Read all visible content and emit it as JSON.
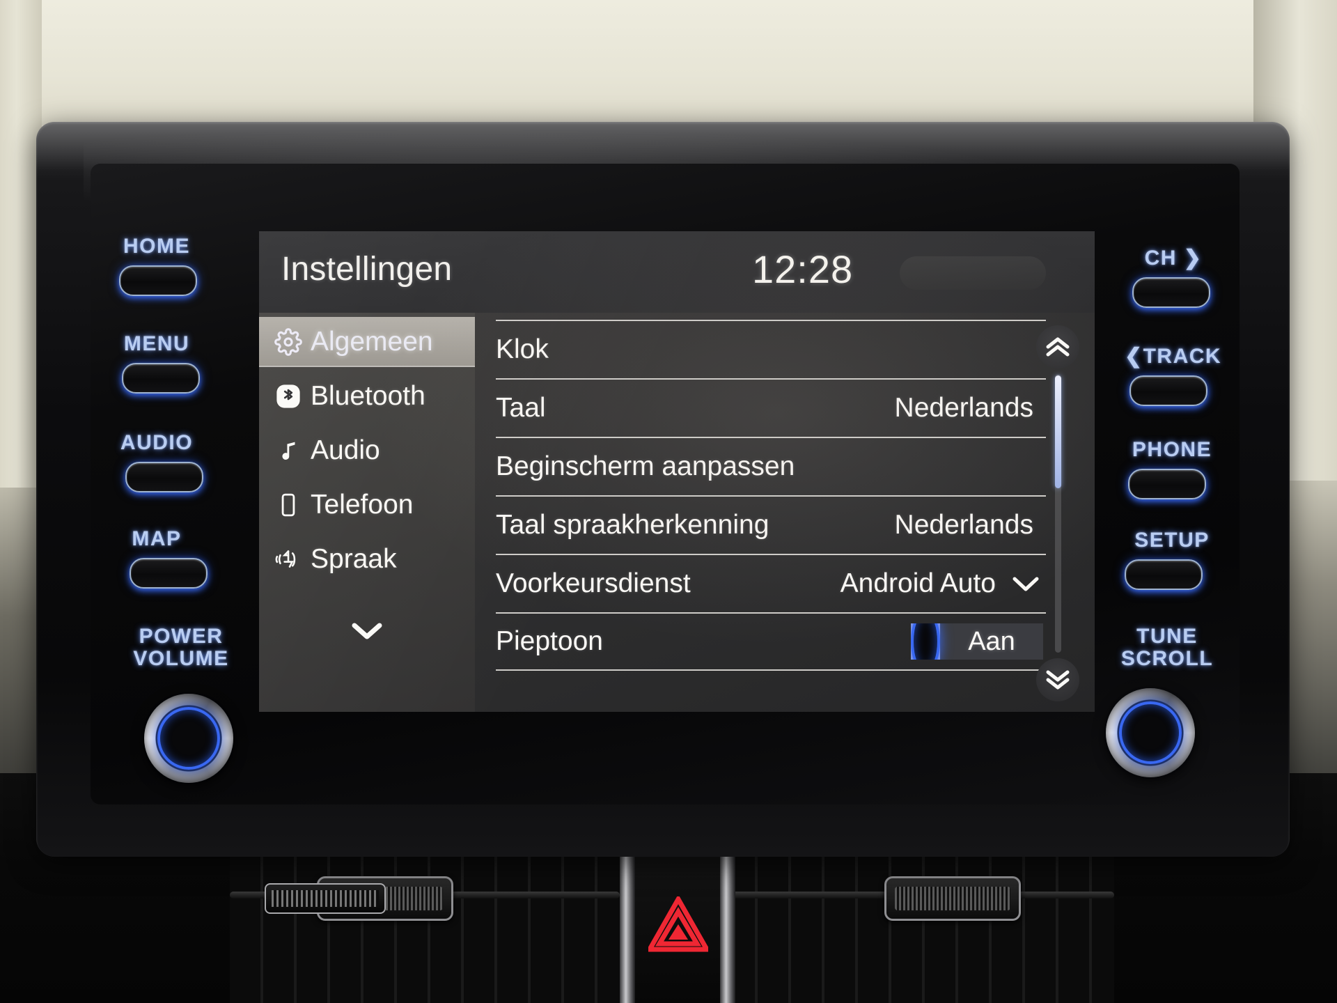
{
  "header": {
    "title": "Instellingen",
    "clock": "12:28"
  },
  "sidebar": {
    "items": [
      {
        "label": "Algemeen",
        "icon": "gear-icon",
        "selected": true
      },
      {
        "label": "Bluetooth",
        "icon": "bluetooth-icon",
        "selected": false
      },
      {
        "label": "Audio",
        "icon": "music-note-icon",
        "selected": false
      },
      {
        "label": "Telefoon",
        "icon": "phone-icon",
        "selected": false
      },
      {
        "label": "Spraak",
        "icon": "voice-icon",
        "selected": false
      }
    ],
    "more_icon": "chevron-down-icon"
  },
  "settings_list": {
    "rows": [
      {
        "label": "Klok",
        "value": "",
        "control": "none"
      },
      {
        "label": "Taal",
        "value": "Nederlands",
        "control": "none"
      },
      {
        "label": "Beginscherm aanpassen",
        "value": "",
        "control": "none"
      },
      {
        "label": "Taal spraakherkenning",
        "value": "Nederlands",
        "control": "none"
      },
      {
        "label": "Voorkeursdienst",
        "value": "Android Auto",
        "control": "dropdown"
      },
      {
        "label": "Pieptoon",
        "value": "Aan",
        "control": "toggle"
      }
    ]
  },
  "scrollbar": {
    "up_icon": "double-chevron-up-icon",
    "down_icon": "double-chevron-down-icon"
  },
  "hardware": {
    "left_buttons": [
      {
        "label": "HOME"
      },
      {
        "label": "MENU"
      },
      {
        "label": "AUDIO"
      },
      {
        "label": "MAP"
      }
    ],
    "left_knob_label": "POWER\nVOLUME",
    "right_buttons": [
      {
        "label": "CH ❯"
      },
      {
        "label": "❮TRACK"
      },
      {
        "label": "PHONE"
      },
      {
        "label": "SETUP"
      }
    ],
    "right_knob_label": "TUNE\nSCROLL"
  },
  "dashboard": {
    "hazard_icon": "hazard-triangle-icon"
  },
  "colors": {
    "accent_blue": "#3c6eff",
    "label_blue": "#b9cdf2",
    "toggle_blue": "#99a5db",
    "hazard_red": "#e8202c",
    "screen_bg": "#2e2e30",
    "dash_cream": "#e9e7d9"
  }
}
